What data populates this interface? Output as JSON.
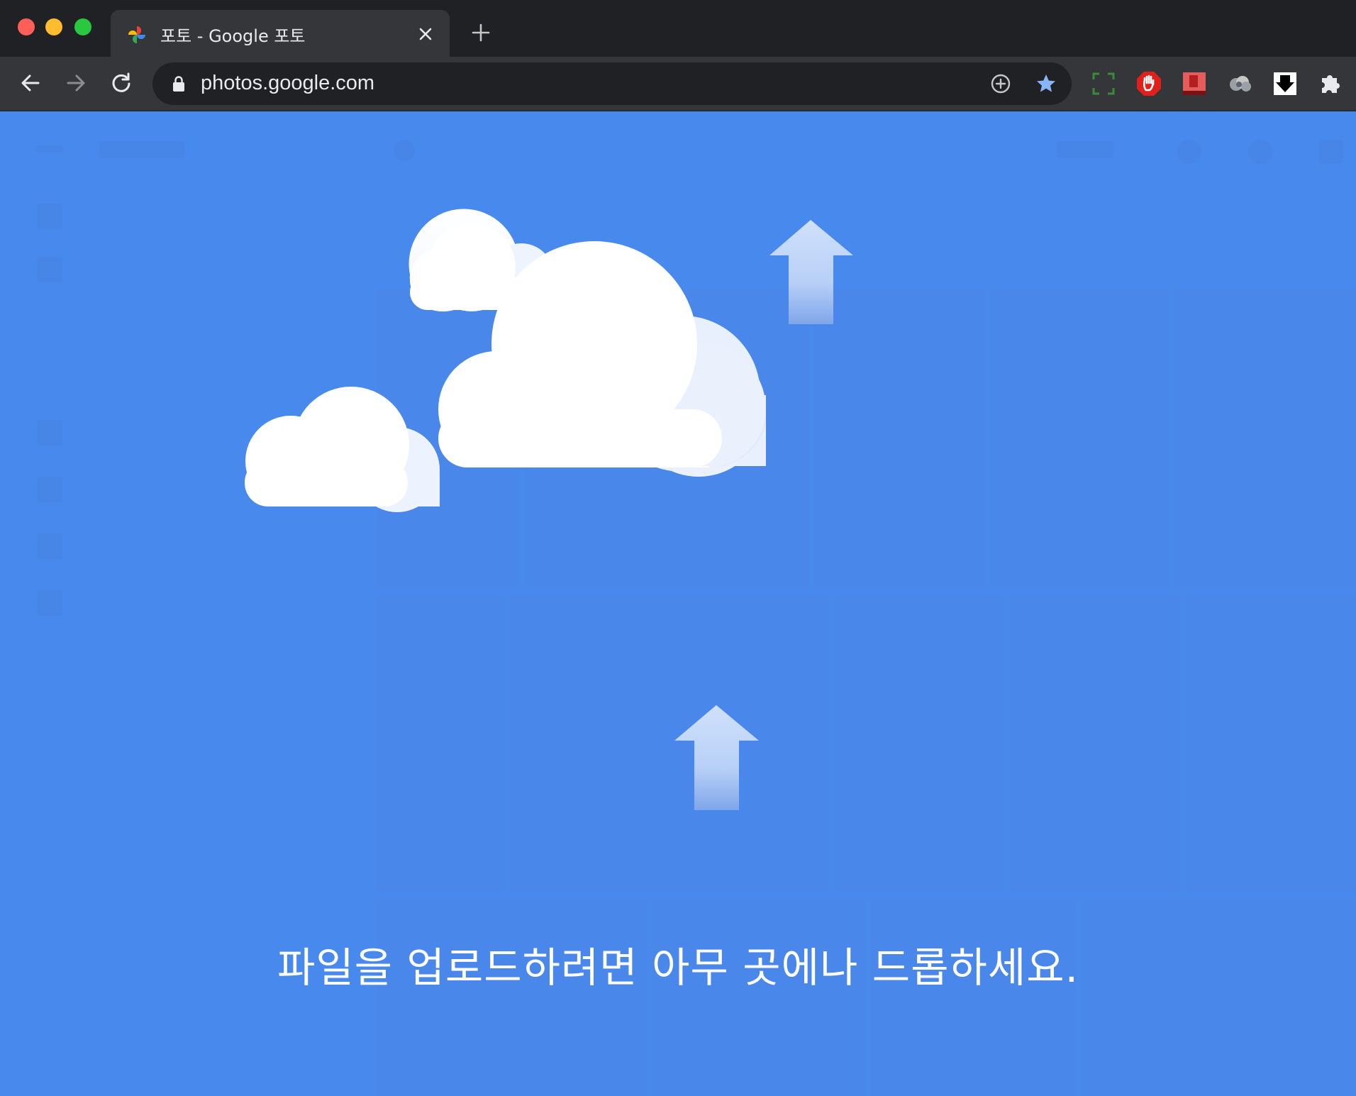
{
  "browser": {
    "tab": {
      "title": "포토 - Google 포토"
    },
    "address_bar": {
      "url": "photos.google.com"
    },
    "icons": {
      "back": "back-arrow-icon",
      "forward": "forward-arrow-icon",
      "reload": "reload-icon",
      "lock": "lock-icon",
      "install": "install-app-icon",
      "bookmark": "bookmark-star-icon",
      "extensions": [
        "screenshot-extension-icon",
        "adblock-extension-icon",
        "pdf-merger-extension-icon",
        "cloud-extension-icon",
        "download-extension-icon",
        "puzzle-extensions-icon"
      ]
    }
  },
  "overlay": {
    "message": "파일을 업로드하려면 아무 곳에나 드롭하세요.",
    "background_color": "#4889ee"
  }
}
